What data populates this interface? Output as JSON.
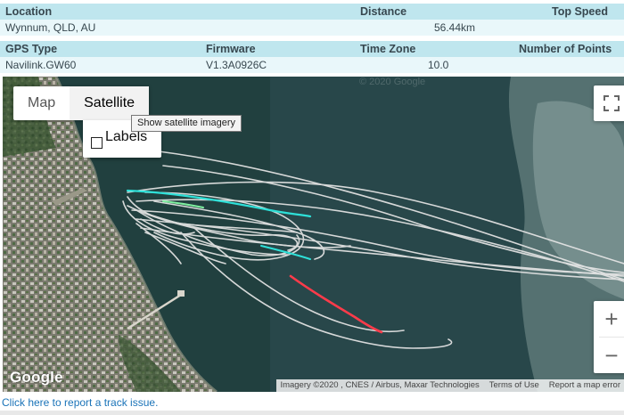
{
  "info": {
    "row1_headers": {
      "location": "Location",
      "distance": "Distance",
      "top_speed": "Top Speed"
    },
    "row1_values": {
      "location": "Wynnum, QLD, AU",
      "distance": "56.44km",
      "top_speed": ""
    },
    "row2_headers": {
      "gps_type": "GPS Type",
      "firmware": "Firmware",
      "time_zone": "Time Zone",
      "points": "Number of Points"
    },
    "row2_values": {
      "gps_type": "Navilink.GW60",
      "firmware": "V1.3A0926C",
      "time_zone": "10.0",
      "points": ""
    }
  },
  "map": {
    "map_type_buttons": [
      "Map",
      "Satellite"
    ],
    "active_map_type": "Satellite",
    "labels_checkbox_label": "Labels",
    "labels_checked": false,
    "tooltip": "Show satellite imagery",
    "zoom_in": "+",
    "zoom_out": "−",
    "google_logo": "Google",
    "watermark": "© 2020 Google",
    "attribution": {
      "imagery": "Imagery ©2020 , CNES / Airbus, Maxar Technologies",
      "terms": "Terms of Use",
      "report": "Report a map error"
    },
    "colors": {
      "track_normal": "#e6e6e6",
      "track_cyan": "#2ee0d8",
      "track_green": "#7ff0a0",
      "track_red": "#ff3b4a",
      "water": "#1f3d3f",
      "shallows": "#6f8b8a"
    }
  },
  "report_link": "Click here to report a track issue."
}
